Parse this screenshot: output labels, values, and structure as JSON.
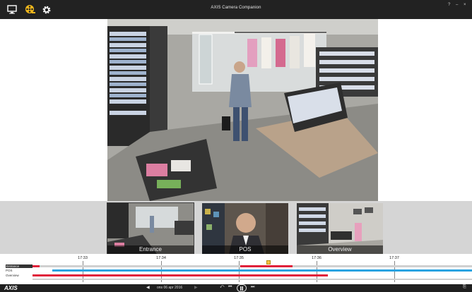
{
  "app": {
    "title": "AXIS Camera Companion",
    "window_controls": [
      "?",
      "–",
      "×"
    ]
  },
  "toolbar": {
    "icons": [
      "monitor-icon",
      "film-reel-icon",
      "gear-icon"
    ]
  },
  "thumbnails": [
    {
      "label": "Entrance"
    },
    {
      "label": "POS"
    },
    {
      "label": "Overview"
    }
  ],
  "timeline": {
    "ticks": [
      "17:33",
      "17:34",
      "17:35",
      "17:36",
      "17:37"
    ],
    "tracks": [
      {
        "label": "Entrance",
        "selected": true
      },
      {
        "label": "POS",
        "selected": false
      },
      {
        "label": "Overview",
        "selected": false
      }
    ],
    "colors": {
      "motion": "#e0203a",
      "continuous": "#2aa3e0",
      "base": "#c8c8c8",
      "cursor": "#f6c343"
    }
  },
  "controls": {
    "date": "ons 06 apr 2016",
    "logo": "AXIS"
  }
}
